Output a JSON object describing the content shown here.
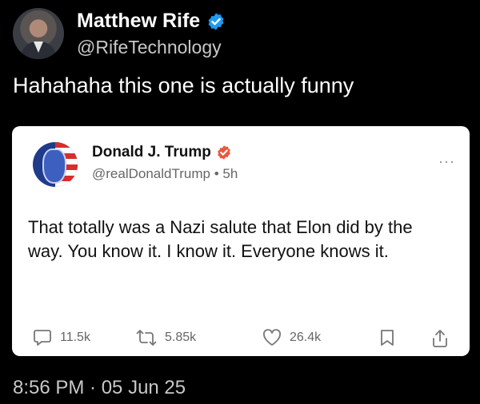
{
  "post": {
    "author_name": "Matthew Rife",
    "handle": "@RifeTechnology",
    "text": "Hahahaha this one is actually funny",
    "timestamp": "8:56 PM · 05 Jun 25"
  },
  "quoted": {
    "author_name": "Donald J. Trump",
    "handle": "@realDonaldTrump",
    "time": "5h",
    "separator": "•",
    "text": "That totally was a Nazi salute that Elon did by the way. You know it. I know it. Everyone knows it.",
    "more": "···",
    "stats": {
      "replies": "11.5k",
      "reposts": "5.85k",
      "likes": "26.4k"
    }
  },
  "colors": {
    "background": "#000000",
    "verified_blue": "#1d9bf0",
    "verified_orange": "#e8593f",
    "card": "#ffffff"
  },
  "icons": {
    "verified": "verified-badge-icon",
    "reply": "reply-icon",
    "repost": "repost-icon",
    "like": "heart-icon",
    "bookmark": "bookmark-icon",
    "share": "share-icon",
    "more": "more-icon"
  }
}
